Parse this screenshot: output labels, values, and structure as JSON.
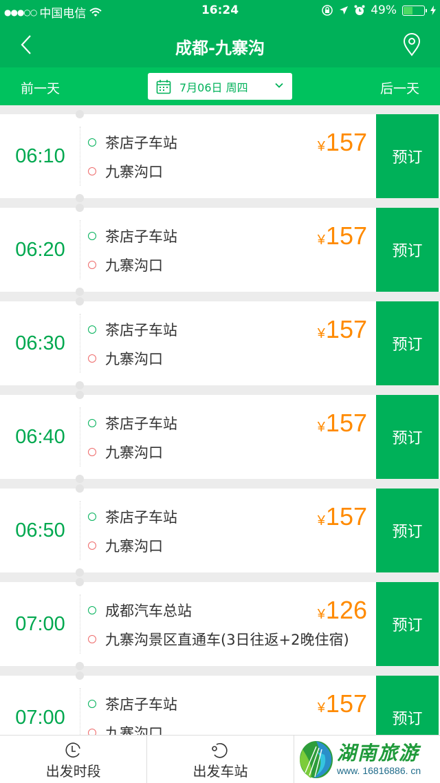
{
  "status_bar": {
    "signal_dots": "●●●○○",
    "carrier": "中国电信",
    "time": "16:24",
    "battery_percent_label": "49%",
    "battery_level": 0.49,
    "icons": [
      "wifi-icon",
      "orientation-lock-icon",
      "location-arrow-icon",
      "alarm-icon",
      "battery-icon",
      "charging-bolt-icon"
    ]
  },
  "nav": {
    "title": "成都-九寨沟",
    "back_icon": "chevron-left-icon",
    "location_icon": "map-pin-icon"
  },
  "date_bar": {
    "prev_label": "前一天",
    "next_label": "后一天",
    "date_label": "7月06日 周四",
    "calendar_icon": "calendar-icon",
    "dropdown_icon": "chevron-down-icon"
  },
  "colors": {
    "brand_green": "#00b159",
    "time_green": "#00a84f",
    "price_orange": "#ff8a00",
    "arrival_red": "#ee6b6b"
  },
  "trips": [
    {
      "time": "06:10",
      "from": "茶店子车站",
      "to": "九寨沟口",
      "currency": "¥",
      "price": "157",
      "book_label": "预订"
    },
    {
      "time": "06:20",
      "from": "茶店子车站",
      "to": "九寨沟口",
      "currency": "¥",
      "price": "157",
      "book_label": "预订"
    },
    {
      "time": "06:30",
      "from": "茶店子车站",
      "to": "九寨沟口",
      "currency": "¥",
      "price": "157",
      "book_label": "预订"
    },
    {
      "time": "06:40",
      "from": "茶店子车站",
      "to": "九寨沟口",
      "currency": "¥",
      "price": "157",
      "book_label": "预订"
    },
    {
      "time": "06:50",
      "from": "茶店子车站",
      "to": "九寨沟口",
      "currency": "¥",
      "price": "157",
      "book_label": "预订"
    },
    {
      "time": "07:00",
      "from": "成都汽车总站",
      "to": "九寨沟景区直通车(3日往返+2晚住宿)",
      "currency": "¥",
      "price": "126",
      "book_label": "预订"
    },
    {
      "time": "07:00",
      "from": "茶店子车站",
      "to": "九寨沟口",
      "currency": "¥",
      "price": "157",
      "book_label": "预订"
    }
  ],
  "tab_bar": {
    "tabs": [
      {
        "label": "出发时段",
        "icon": "clock-icon"
      },
      {
        "label": "出发车站",
        "icon": "station-icon"
      }
    ]
  },
  "watermark": {
    "title": "湖南旅游",
    "url": "www. 16816886. cn"
  }
}
